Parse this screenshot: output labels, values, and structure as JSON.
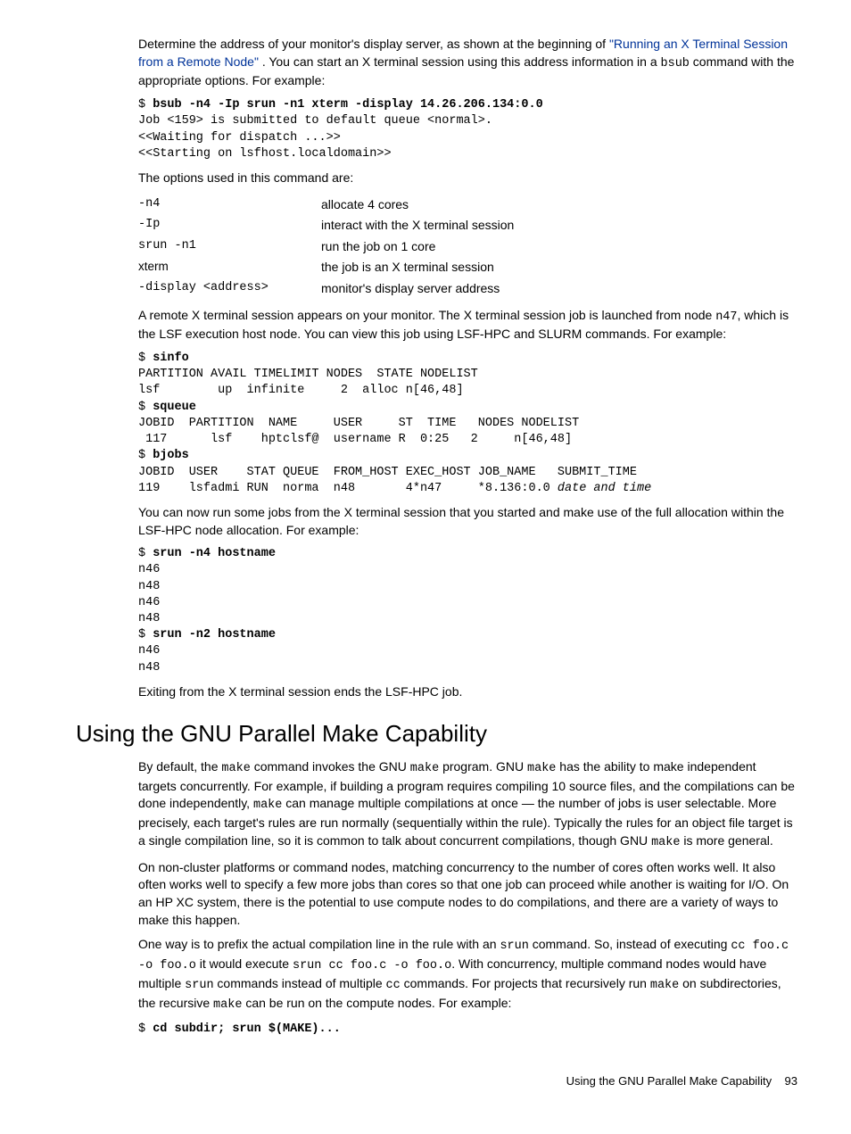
{
  "p1_a": "Determine the address of your monitor's display server, as shown at the beginning of ",
  "p1_link": "\"Running an X Terminal Session from a Remote Node\"",
  "p1_b": " . You can start an X terminal session using this address information in a ",
  "p1_code": "bsub",
  "p1_c": " command with the appropriate options. For example:",
  "block1_prompt": "$ ",
  "block1_cmd": "bsub -n4 -Ip srun -n1 xterm -display 14.26.206.134:0.0",
  "block1_out": "Job <159> is submitted to default queue <normal>.\n<<Waiting for dispatch ...>>\n<<Starting on lsfhost.localdomain>>",
  "p2": "The options used in this command are:",
  "opts": [
    {
      "c1": "-n4",
      "c2": "allocate 4 cores",
      "mono": true
    },
    {
      "c1": "-Ip",
      "c2": "interact with the X terminal session",
      "mono": true
    },
    {
      "c1": "srun -n1",
      "c2": "run the job on 1 core",
      "mono": true
    },
    {
      "c1": "xterm",
      "c2": "the job is an X terminal session",
      "mono": false
    },
    {
      "c1": "-display <address>",
      "c2": "monitor's display server address",
      "mono": true
    }
  ],
  "p3_a": "A remote X terminal session appears on your monitor. The X terminal session job is launched from node ",
  "p3_code": "n47",
  "p3_b": ", which is the LSF execution host node. You can view this job using LSF-HPC and SLURM commands. For example:",
  "block2": {
    "l1_p": "$ ",
    "l1_c": "sinfo",
    "l2": "PARTITION AVAIL TIMELIMIT NODES  STATE NODELIST",
    "l3": "lsf        up  infinite     2  alloc n[46,48]",
    "l4_p": "$ ",
    "l4_c": "squeue",
    "l5": "JOBID  PARTITION  NAME     USER     ST  TIME   NODES NODELIST",
    "l6": " 117      lsf    hptclsf@  username R  0:25   2     n[46,48]",
    "l7_p": "$ ",
    "l7_c": "bjobs",
    "l8": "JOBID  USER    STAT QUEUE  FROM_HOST EXEC_HOST JOB_NAME   SUBMIT_TIME",
    "l9_a": "119    lsfadmi RUN  norma  n48       4*n47     *8.136:0.0 ",
    "l9_b": "date and time"
  },
  "p4": "You can now run some jobs from the X terminal session that you started and make use of the full allocation within the LSF-HPC node allocation. For example:",
  "block3": {
    "l1_p": "$ ",
    "l1_c": "srun -n4 hostname",
    "l2": "n46\nn48\nn46\nn48",
    "l3_p": "$ ",
    "l3_c": "srun -n2 hostname",
    "l4": "n46\nn48"
  },
  "p5": "Exiting from the X terminal session ends the LSF-HPC job.",
  "h2": "Using the GNU Parallel Make Capability",
  "p6_a": "By default, the ",
  "p6_m1": "make",
  "p6_b": " command invokes the GNU ",
  "p6_m2": "make",
  "p6_c": " program. GNU ",
  "p6_m3": "make",
  "p6_d": " has the ability to make independent targets concurrently. For example, if building a program requires compiling 10 source files, and the compilations can be done independently, ",
  "p6_m4": "make",
  "p6_e": " can manage multiple compilations at once — the number of jobs is user selectable. More precisely, each target's rules are run normally (sequentially within the rule). Typically the rules for an object file target is a single compilation line, so it is common to talk about concurrent compilations, though GNU ",
  "p6_m5": "make",
  "p6_f": " is more general.",
  "p7": "On non-cluster platforms or command nodes, matching concurrency to the number of cores often works well. It also often works well to specify a few more jobs than cores so that one job can proceed while another is waiting for I/O. On an HP XC system, there is the potential to use compute nodes to do compilations, and there are a variety of ways to make this happen.",
  "p8_a": "One way is to prefix the actual compilation line in the rule with an ",
  "p8_m1": "srun",
  "p8_b": " command. So, instead of executing ",
  "p8_m2": "cc foo.c -o foo.o",
  "p8_c": " it would execute ",
  "p8_m3": "srun cc foo.c -o foo.o",
  "p8_d": ". With concurrency, multiple command nodes would have multiple ",
  "p8_m4": "srun",
  "p8_e": " commands instead of multiple ",
  "p8_m5": "cc",
  "p8_f": " commands. For projects that recursively run ",
  "p8_m6": "make",
  "p8_g": " on subdirectories, the recursive ",
  "p8_m7": "make",
  "p8_h": " can be run on the compute nodes. For example:",
  "block4_p": "$ ",
  "block4_c": "cd subdir; srun $(MAKE)...",
  "footer_a": "Using the GNU Parallel Make Capability",
  "footer_b": "93"
}
